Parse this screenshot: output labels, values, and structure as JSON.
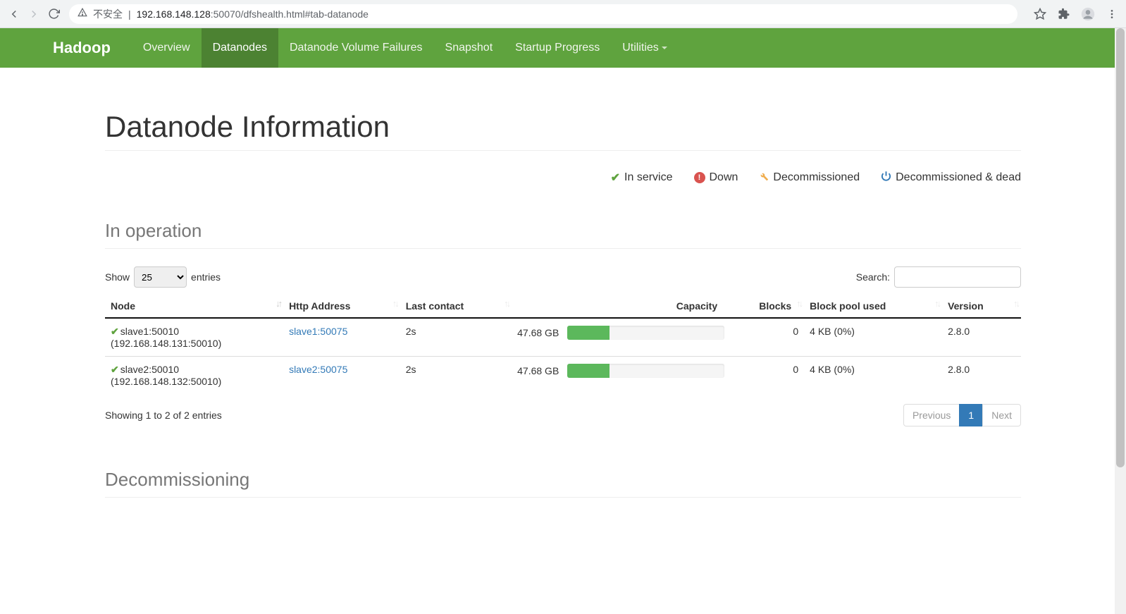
{
  "browser": {
    "url_insecure_label": "不安全",
    "url_host": "192.168.148.128",
    "url_port_path": ":50070/dfshealth.html#tab-datanode"
  },
  "navbar": {
    "brand": "Hadoop",
    "items": [
      {
        "label": "Overview",
        "active": false
      },
      {
        "label": "Datanodes",
        "active": true
      },
      {
        "label": "Datanode Volume Failures",
        "active": false
      },
      {
        "label": "Snapshot",
        "active": false
      },
      {
        "label": "Startup Progress",
        "active": false
      },
      {
        "label": "Utilities",
        "active": false,
        "dropdown": true
      }
    ]
  },
  "page": {
    "title": "Datanode Information",
    "legend": {
      "in_service": "In service",
      "down": "Down",
      "decommissioned": "Decommissioned",
      "decommissioned_dead": "Decommissioned & dead"
    },
    "section_in_operation": "In operation",
    "section_decommissioning": "Decommissioning"
  },
  "datatable": {
    "show_label": "Show",
    "entries_label": "entries",
    "length_value": "25",
    "search_label": "Search:",
    "columns": {
      "node": "Node",
      "http": "Http Address",
      "last_contact": "Last contact",
      "capacity": "Capacity",
      "blocks": "Blocks",
      "block_pool": "Block pool used",
      "version": "Version"
    },
    "rows": [
      {
        "node_name": "slave1:50010",
        "node_ip": "(192.168.148.131:50010)",
        "http": "slave1:50075",
        "last_contact": "2s",
        "capacity_text": "47.68 GB",
        "capacity_pct": 27,
        "blocks": "0",
        "block_pool": "4 KB (0%)",
        "version": "2.8.0"
      },
      {
        "node_name": "slave2:50010",
        "node_ip": "(192.168.148.132:50010)",
        "http": "slave2:50075",
        "last_contact": "2s",
        "capacity_text": "47.68 GB",
        "capacity_pct": 27,
        "blocks": "0",
        "block_pool": "4 KB (0%)",
        "version": "2.8.0"
      }
    ],
    "info": "Showing 1 to 2 of 2 entries",
    "pagination": {
      "previous": "Previous",
      "page": "1",
      "next": "Next"
    }
  }
}
